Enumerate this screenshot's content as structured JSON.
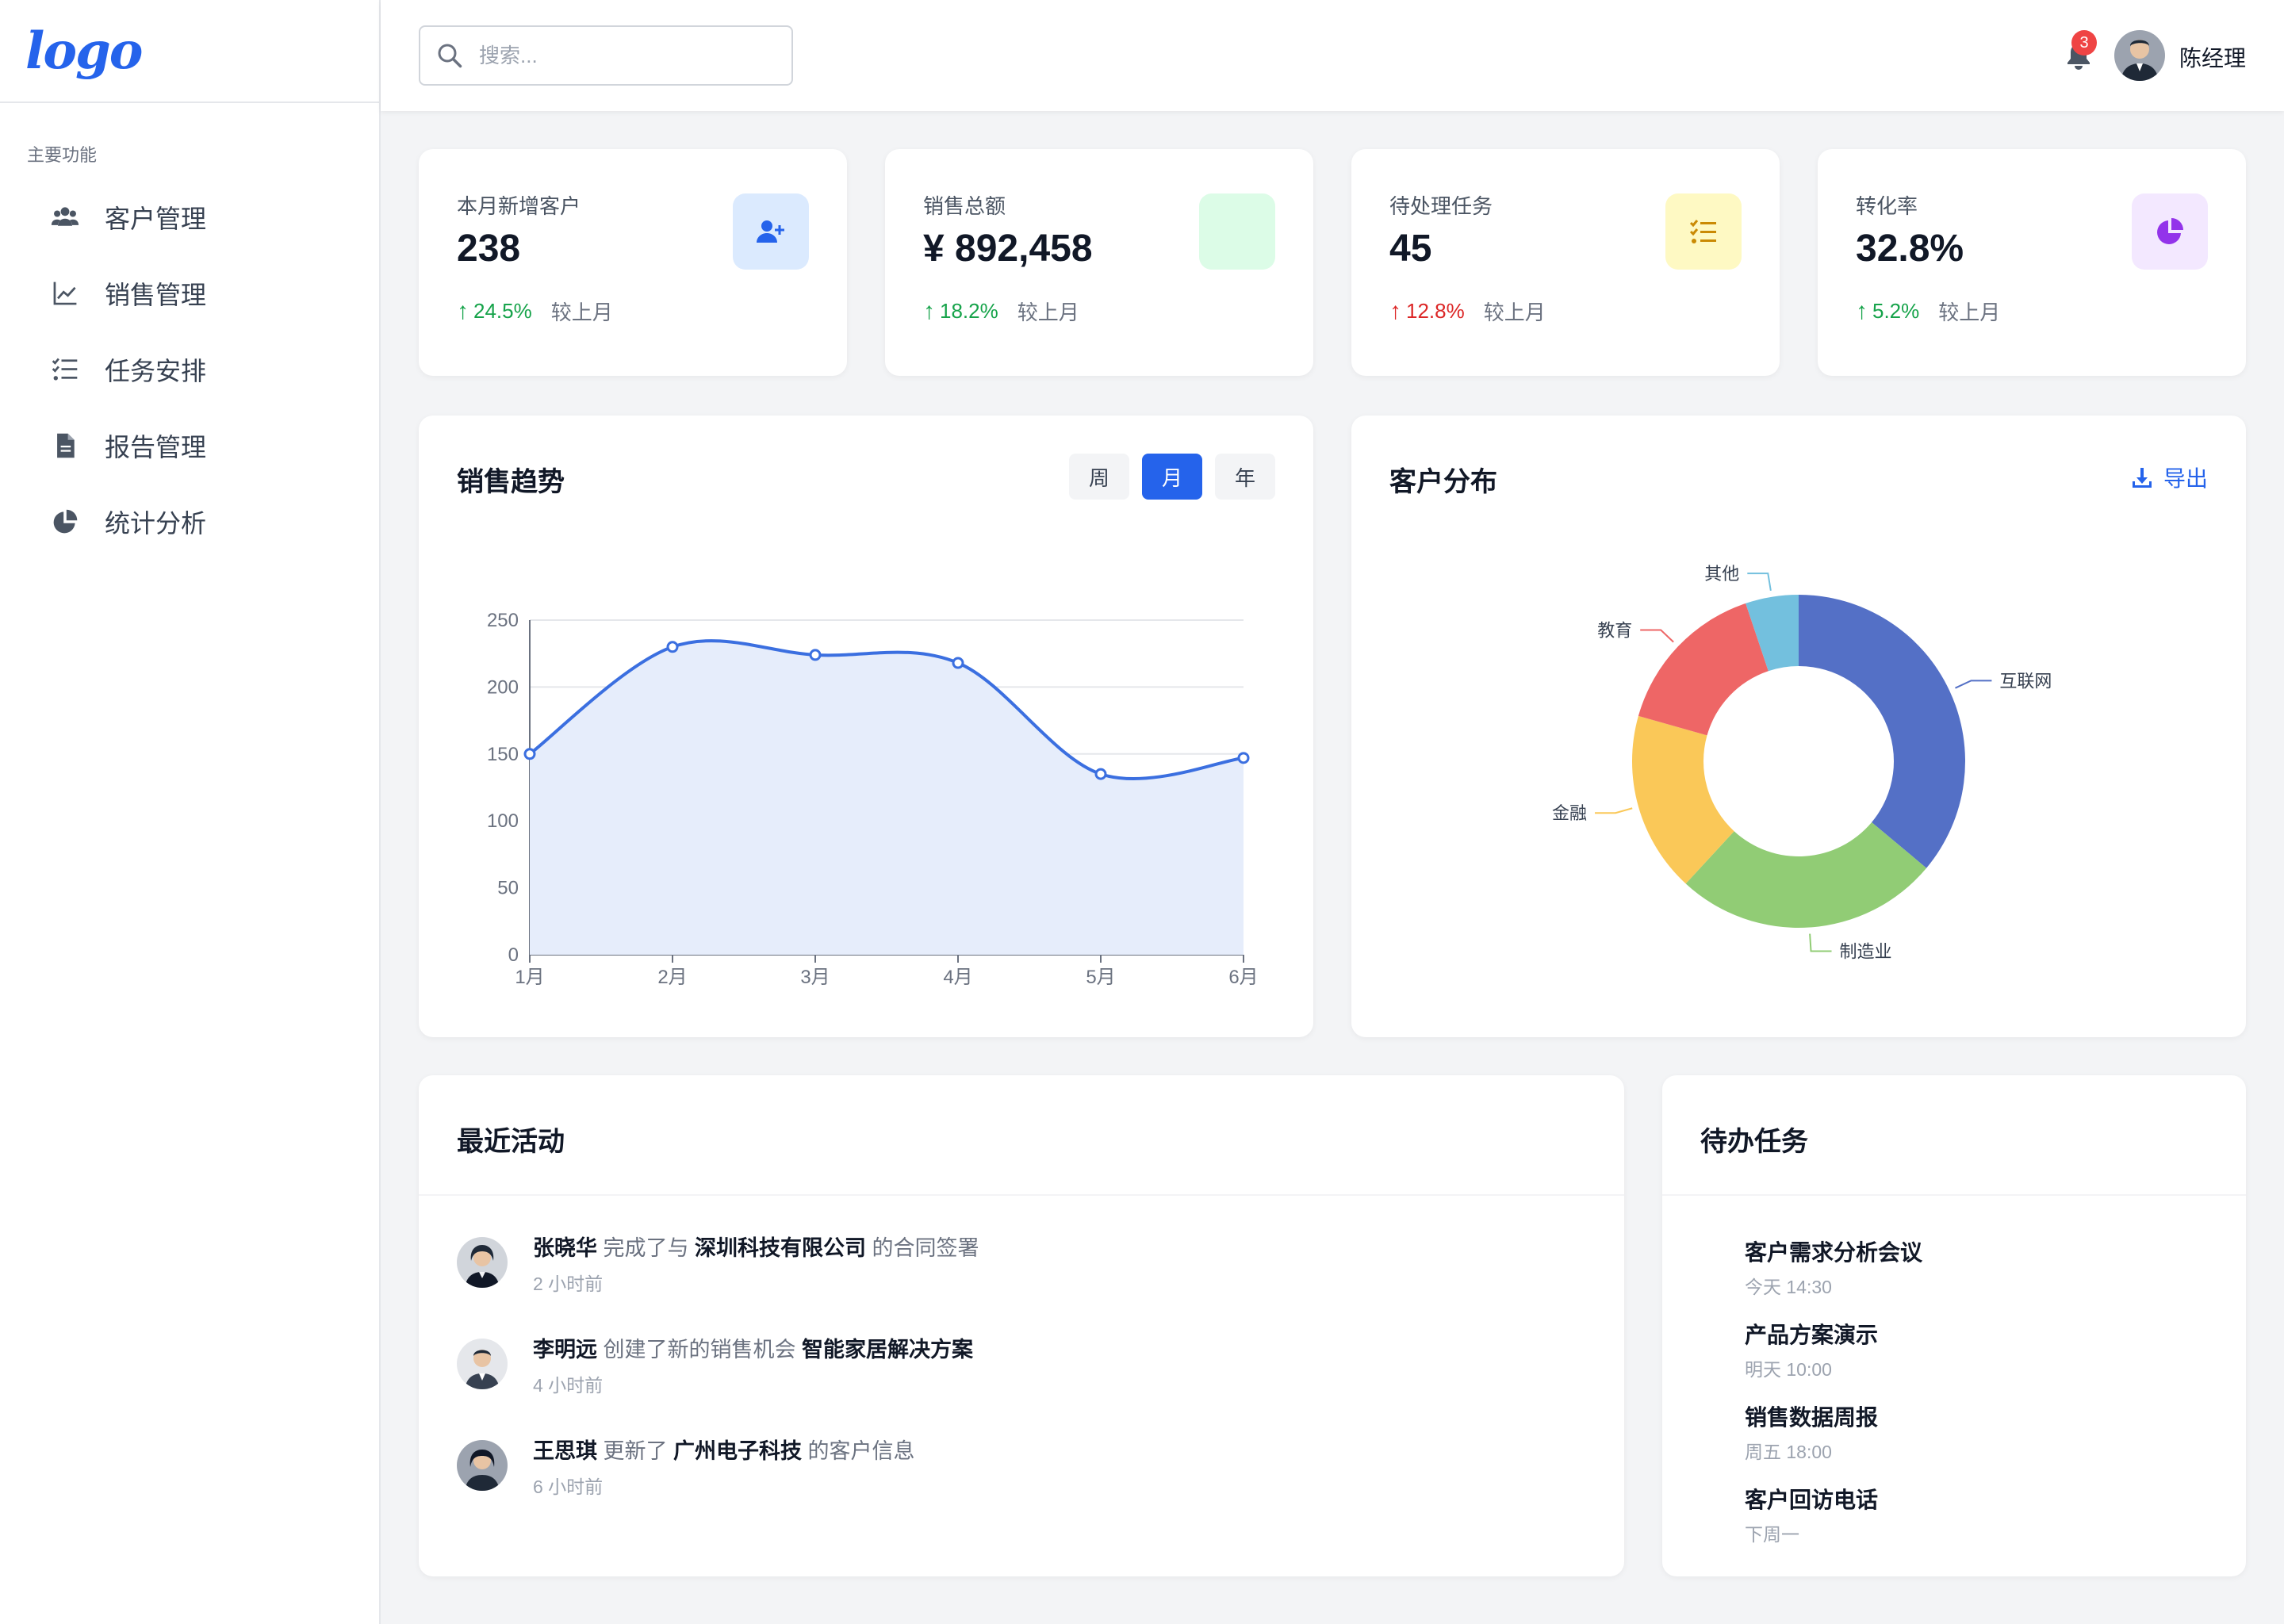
{
  "app": {
    "logo_text": "logo",
    "brand_color": "#2563eb"
  },
  "sidebar": {
    "section_label": "主要功能",
    "items": [
      {
        "label": "客户管理",
        "icon": "users-icon"
      },
      {
        "label": "销售管理",
        "icon": "line-chart-icon"
      },
      {
        "label": "任务安排",
        "icon": "task-list-icon"
      },
      {
        "label": "报告管理",
        "icon": "file-icon"
      },
      {
        "label": "统计分析",
        "icon": "pie-chart-icon"
      }
    ]
  },
  "header": {
    "search_placeholder": "搜索...",
    "notification_count": "3",
    "user_name": "陈经理"
  },
  "stats": [
    {
      "label": "本月新增客户",
      "value": "238",
      "change": "24.5%",
      "direction": "up",
      "change_color": "#16a34a",
      "compare": "较上月",
      "icon": "user-plus-icon",
      "icon_bg": "#dbeafe",
      "icon_color": "#2563eb"
    },
    {
      "label": "销售总额",
      "value": "¥ 892,458",
      "change": "18.2%",
      "direction": "up",
      "change_color": "#16a34a",
      "compare": "较上月",
      "icon": "none",
      "icon_bg": "#dcfce7",
      "icon_color": "#16a34a"
    },
    {
      "label": "待处理任务",
      "value": "45",
      "change": "12.8%",
      "direction": "up",
      "change_color": "#dc2626",
      "compare": "较上月",
      "icon": "task-list-icon",
      "icon_bg": "#fef9c3",
      "icon_color": "#ca8a04"
    },
    {
      "label": "转化率",
      "value": "32.8%",
      "change": "5.2%",
      "direction": "up",
      "change_color": "#16a34a",
      "compare": "较上月",
      "icon": "pie-chart-icon",
      "icon_bg": "#f3e8ff",
      "icon_color": "#9333ea"
    }
  ],
  "sales_trend": {
    "title": "销售趋势",
    "periods": [
      "周",
      "月",
      "年"
    ],
    "active_period": "月"
  },
  "customer_dist": {
    "title": "客户分布",
    "export_label": "导出"
  },
  "chart_data": [
    {
      "type": "area",
      "title": "销售趋势",
      "categories": [
        "1月",
        "2月",
        "3月",
        "4月",
        "5月",
        "6月"
      ],
      "series": [
        {
          "values": [
            150,
            230,
            224,
            218,
            135,
            147
          ]
        }
      ],
      "yticks": [
        "0",
        "50",
        "100",
        "150",
        "200",
        "250"
      ],
      "ylim": [
        0,
        250
      ],
      "grid": true,
      "color": "#3b6fe0"
    },
    {
      "type": "pie",
      "donut": true,
      "slices": [
        {
          "label": "互联网",
          "value": 35,
          "color": "#5470c6"
        },
        {
          "label": "制造业",
          "value": 25,
          "color": "#91cc75"
        },
        {
          "label": "金融",
          "value": 17,
          "color": "#fac858"
        },
        {
          "label": "教育",
          "value": 15,
          "color": "#ee6666"
        },
        {
          "label": "其他",
          "value": 5,
          "color": "#73c0de"
        }
      ]
    }
  ],
  "recent_activity": {
    "title": "最近活动",
    "items": [
      {
        "user": "张晓华",
        "action": "完成了与",
        "target": "深圳科技有限公司",
        "suffix": "的合同签署",
        "time": "2 小时前"
      },
      {
        "user": "李明远",
        "action": "创建了新的销售机会",
        "target": "智能家居解决方案",
        "suffix": "",
        "time": "4 小时前"
      },
      {
        "user": "王思琪",
        "action": "更新了",
        "target": "广州电子科技",
        "suffix": "的客户信息",
        "time": "6 小时前"
      }
    ]
  },
  "todo": {
    "title": "待办任务",
    "items": [
      {
        "title": "客户需求分析会议",
        "time": "今天 14:30"
      },
      {
        "title": "产品方案演示",
        "time": "明天 10:00"
      },
      {
        "title": "销售数据周报",
        "time": "周五 18:00"
      },
      {
        "title": "客户回访电话",
        "time": "下周一"
      }
    ]
  }
}
